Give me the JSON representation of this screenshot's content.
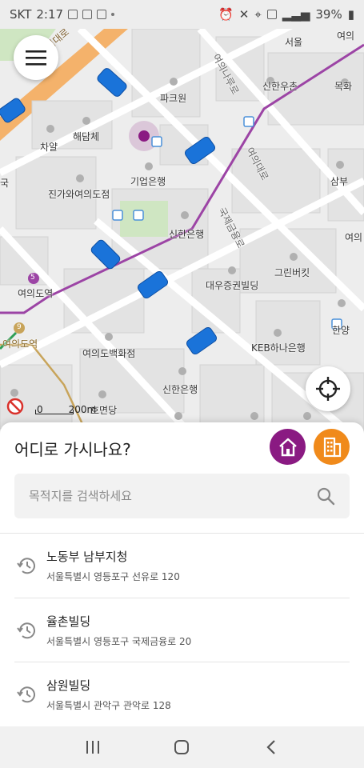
{
  "status_bar": {
    "carrier": "SKT",
    "time": "2:17",
    "battery": "39%"
  },
  "map": {
    "labels": {
      "seoul": "서울",
      "yeouido_station_top": "여의",
      "parkone": "파크원",
      "shinhan_woochun": "신한우촌",
      "mokhwa": "목화",
      "chayal": "차얄",
      "haedamche": "해담체",
      "ibk": "기업은행",
      "samboo": "삼부",
      "kor": "국",
      "jingawa": "진가와여의도점",
      "yeoui_right": "여의",
      "shinhan_bank": "신한은행",
      "greenbekit": "그린버킷",
      "daewoo": "대우증권빌딩",
      "yeouido_station_5": "여의도역",
      "hanyang": "한양",
      "yeouido_station_9": "여의도역",
      "kebhana": "KEB하나은행",
      "yeouido_dept": "여의도백화점",
      "shinhan_bank2": "신한은행",
      "homyeondang": "호면당",
      "road1": "의대로",
      "road2": "여의나루로",
      "road3": "여의대로",
      "road4": "국제금융로"
    },
    "line5_badge": "5",
    "line9_badge": "9",
    "scale_zero": "0",
    "scale_text": "200m",
    "brand_purple": "#8a1a82",
    "taxi_color": "#1a73d9"
  },
  "panel": {
    "title": "어디로 가시나요?",
    "home_icon": "home-icon",
    "work_icon": "building-icon",
    "search_placeholder": "목적지를 검색하세요",
    "recent": [
      {
        "name": "노동부 남부지청",
        "address": "서울특별시 영등포구 선유로 120"
      },
      {
        "name": "율촌빌딩",
        "address": "서울특별시 영등포구 국제금융로 20"
      },
      {
        "name": "삼원빌딩",
        "address": "서울특별시 관악구 관악로 128"
      }
    ]
  },
  "navbar": {
    "recents_icon": "recent-apps-icon",
    "home_icon": "nav-home-icon",
    "back_icon": "back-icon"
  }
}
